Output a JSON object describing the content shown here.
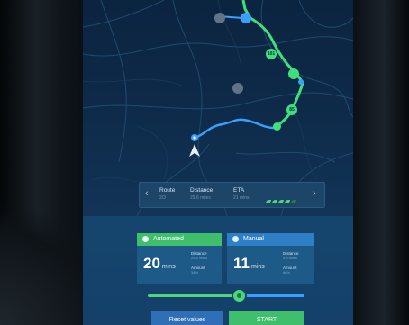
{
  "route_bar": {
    "prev_icon": "chevron-left-icon",
    "next_icon": "chevron-right-icon",
    "route_label": "Route",
    "route_value": "2/3",
    "distance_label": "Distance",
    "distance_value": "29.6 miles",
    "eta_label": "ETA",
    "eta_value": "21 mins",
    "efficiency_level": 4,
    "efficiency_max": 5
  },
  "map": {
    "highway_labels": [
      "101",
      "85"
    ],
    "route_color": "#3fe07c",
    "alt_route_color": "#3aa0ff",
    "position_icon": "navigation-arrow-icon"
  },
  "cards": {
    "automated": {
      "title": "Automated",
      "time_value": "20",
      "time_unit": "mins",
      "distance_label": "Distance",
      "distance_value": "29.6 miles",
      "amount_label": "Amount",
      "amount_value": "34%",
      "color": "#4ed67c"
    },
    "manual": {
      "title": "Manual",
      "time_value": "11",
      "time_unit": "mins",
      "distance_label": "Distance",
      "distance_value": "9.8 miles",
      "amount_label": "Amount",
      "amount_value": "66%",
      "color": "#3aa0ff"
    }
  },
  "slider": {
    "value_fraction": 0.58
  },
  "buttons": {
    "reset_label": "Reset values",
    "start_label": "START"
  }
}
